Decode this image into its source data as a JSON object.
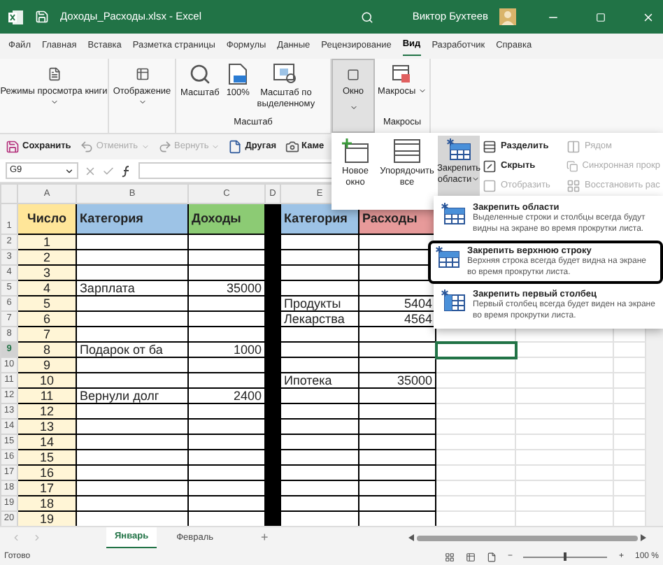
{
  "window": {
    "title": "Доходы_Расходы.xlsx - Excel",
    "user": "Виктор Бухтеев"
  },
  "menu_tabs": [
    {
      "label": "Файл",
      "selected": false
    },
    {
      "label": "Главная",
      "selected": false
    },
    {
      "label": "Вставка",
      "selected": false
    },
    {
      "label": "Разметка страницы",
      "selected": false
    },
    {
      "label": "Формулы",
      "selected": false
    },
    {
      "label": "Данные",
      "selected": false
    },
    {
      "label": "Рецензирование",
      "selected": false
    },
    {
      "label": "Вид",
      "selected": true
    },
    {
      "label": "Разработчик",
      "selected": false
    },
    {
      "label": "Справка",
      "selected": false
    }
  ],
  "ribbon": {
    "view_modes": "Режимы просмотра книги",
    "display": "Отображение",
    "zoom_group": {
      "label": "Масштаб",
      "buttons": [
        "Масштаб",
        "100%",
        "Масштаб по выделенному"
      ]
    },
    "window_button": {
      "label": "Окно",
      "pressed": true
    },
    "macros_group": {
      "label": "Макросы",
      "button": "Макросы"
    }
  },
  "quick_access": [
    {
      "label": "Сохранить",
      "kind": "save",
      "disabled": false,
      "dropdown": false
    },
    {
      "label": "Отменить",
      "kind": "undo",
      "disabled": true,
      "dropdown": true
    },
    {
      "label": "Вернуть",
      "kind": "redo",
      "disabled": true,
      "dropdown": true
    },
    {
      "label": "Другая",
      "kind": "other",
      "disabled": false,
      "dropdown": false
    },
    {
      "label": "Каме",
      "kind": "camera",
      "disabled": false,
      "dropdown": false
    }
  ],
  "formula_bar": {
    "name_box": "G9"
  },
  "window_panel": {
    "big_buttons": [
      {
        "label": "Новое окно",
        "kind": "new",
        "selected": false
      },
      {
        "label": "Упорядочить все",
        "kind": "arrange",
        "selected": false
      },
      {
        "label": "Закрепить области",
        "kind": "freeze",
        "selected": true
      }
    ],
    "small_buttons": [
      {
        "label": "Разделить",
        "kind": "split",
        "disabled": false
      },
      {
        "label": "Скрыть",
        "kind": "hide",
        "disabled": false
      },
      {
        "label": "Отобразить",
        "kind": "unhide",
        "disabled": true
      },
      {
        "label": "Рядом",
        "kind": "side",
        "disabled": true
      },
      {
        "label": "Синхронная прокр",
        "kind": "sync",
        "disabled": true
      },
      {
        "label": "Восстановить рас",
        "kind": "reset",
        "disabled": true
      }
    ]
  },
  "freeze_menu": [
    {
      "title": "Закрепить области",
      "description": "Выделенные строки и столбцы всегда будут видны на экране во время прокрутки листа.",
      "selected": false
    },
    {
      "title": "Закрепить верхнюю строку",
      "description": "Верхняя строка всегда будет видна на экране во время прокрутки листа.",
      "selected": true
    },
    {
      "title": "Закрепить первый столбец",
      "description": "Первый столбец всегда будет виден на экране во время прокрутки листа.",
      "selected": false
    }
  ],
  "sheet": {
    "columns": [
      "A",
      "B",
      "C",
      "D",
      "E"
    ],
    "header": {
      "row": "1",
      "cells": [
        {
          "text": "Число",
          "color": "#ffe699"
        },
        {
          "text": "Категория",
          "color": "#9dc3e6"
        },
        {
          "text": "Доходы",
          "color": "#8ccb74"
        },
        {
          "text": "Категория",
          "color": "#9dc3e6"
        },
        {
          "text": "Расходы",
          "color": "#e79a9a"
        }
      ]
    },
    "rows": [
      {
        "row": "2",
        "number": "1",
        "selected": false
      },
      {
        "row": "3",
        "number": "2",
        "selected": false
      },
      {
        "row": "4",
        "number": "3",
        "selected": false
      },
      {
        "row": "5",
        "number": "4",
        "income_category": "Зарплата",
        "income": "35000",
        "selected": false
      },
      {
        "row": "6",
        "number": "5",
        "expense_category": "Продукты",
        "expense": "5404",
        "selected": false
      },
      {
        "row": "7",
        "number": "6",
        "expense_category": "Лекарства",
        "expense": "4564",
        "selected": false
      },
      {
        "row": "8",
        "number": "7",
        "selected": false
      },
      {
        "row": "9",
        "number": "8",
        "income_category": "Подарок от ба",
        "income": "1000",
        "selected": true
      },
      {
        "row": "10",
        "number": "9",
        "selected": false
      },
      {
        "row": "11",
        "number": "10",
        "expense_category": "Ипотека",
        "expense": "35000",
        "selected": false
      },
      {
        "row": "12",
        "number": "11",
        "income_category": "Вернули долг",
        "income": "2400",
        "selected": false
      },
      {
        "row": "13",
        "number": "12",
        "selected": false
      },
      {
        "row": "14",
        "number": "13",
        "selected": false
      },
      {
        "row": "15",
        "number": "14",
        "selected": false
      },
      {
        "row": "16",
        "number": "15",
        "selected": false
      },
      {
        "row": "17",
        "number": "16",
        "selected": false
      },
      {
        "row": "18",
        "number": "17",
        "selected": false
      },
      {
        "row": "19",
        "number": "18",
        "selected": false
      },
      {
        "row": "20",
        "number": "19",
        "selected": false
      }
    ]
  },
  "sheet_tabs": [
    {
      "label": "Январь",
      "selected": true
    },
    {
      "label": "Февраль",
      "selected": false
    }
  ],
  "add_sheet": "+",
  "status_bar": {
    "text": "Готово",
    "zoom": "100 %",
    "zoom_minus": "−",
    "zoom_plus": "+",
    "level": 0.5
  }
}
